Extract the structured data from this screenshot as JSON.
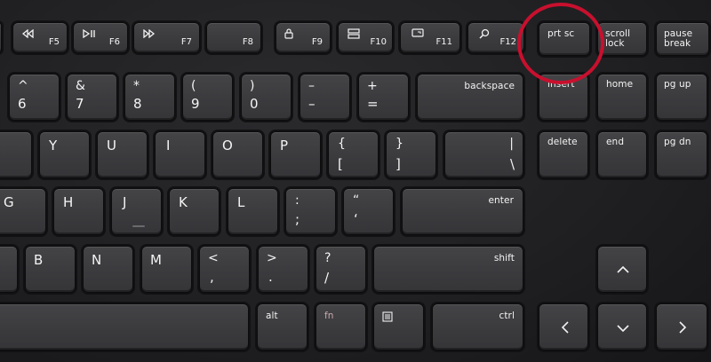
{
  "function_row": {
    "f5": {
      "label": "F5",
      "icon": "rewind-icon"
    },
    "f6": {
      "label": "F6",
      "icon": "play-pause-icon"
    },
    "f7": {
      "label": "F7",
      "icon": "fast-forward-icon"
    },
    "f8": {
      "label": "F8"
    },
    "f9": {
      "label": "F9",
      "icon": "lock-icon"
    },
    "f10": {
      "label": "F10",
      "icon": "display-mode-icon"
    },
    "f11": {
      "label": "F11",
      "icon": "screen-icon"
    },
    "f12": {
      "label": "F12",
      "icon": "search-icon"
    },
    "prtsc": {
      "label": "prt sc"
    },
    "scroll_lock": {
      "line1": "scroll",
      "line2": "lock"
    },
    "pause_break": {
      "line1": "pause",
      "line2": "break"
    }
  },
  "number_row": {
    "six": {
      "top": "^",
      "bottom": "6"
    },
    "seven": {
      "top": "&",
      "bottom": "7"
    },
    "eight": {
      "top": "*",
      "bottom": "8"
    },
    "nine": {
      "top": "(",
      "bottom": "9"
    },
    "zero": {
      "top": ")",
      "bottom": "0"
    },
    "minus": {
      "top": "–",
      "bottom": "–"
    },
    "plus": {
      "top": "+",
      "bottom": "="
    },
    "backspace": "backspace",
    "insert": "insert",
    "home": "home",
    "pg_up": "pg up"
  },
  "top_row": {
    "y": "Y",
    "u": "U",
    "i": "I",
    "o": "O",
    "p": "P",
    "bracket_open": {
      "top": "{",
      "bottom": "["
    },
    "bracket_close": {
      "top": "}",
      "bottom": "]"
    },
    "backslash": {
      "top": "|",
      "bottom": "\\"
    },
    "delete": "delete",
    "end": "end",
    "pg_dn": "pg dn"
  },
  "home_row": {
    "g": "G",
    "h": "H",
    "j": "J",
    "k": "K",
    "l": "L",
    "semicolon": {
      "top": ":",
      "bottom": ";"
    },
    "quote": {
      "top": "“",
      "bottom": "‘"
    },
    "enter": "enter"
  },
  "bottom_row": {
    "b": "B",
    "n": "N",
    "m": "M",
    "comma": {
      "top": "<",
      "bottom": ","
    },
    "period": {
      "top": ">",
      "bottom": "."
    },
    "slash": {
      "top": "?",
      "bottom": "/"
    },
    "shift": "shift"
  },
  "space_row": {
    "alt": "alt",
    "fn": "fn",
    "menu": {
      "icon": "menu-icon"
    },
    "ctrl": "ctrl"
  },
  "arrows": {
    "up": "^",
    "left": "<",
    "down": "v",
    "right": ">"
  },
  "highlight": {
    "color": "#c8102e",
    "target": "prt sc"
  },
  "colors": {
    "key": "#3e3e41",
    "background": "#1b1b1d",
    "fn_label": "#c9a9a9"
  }
}
